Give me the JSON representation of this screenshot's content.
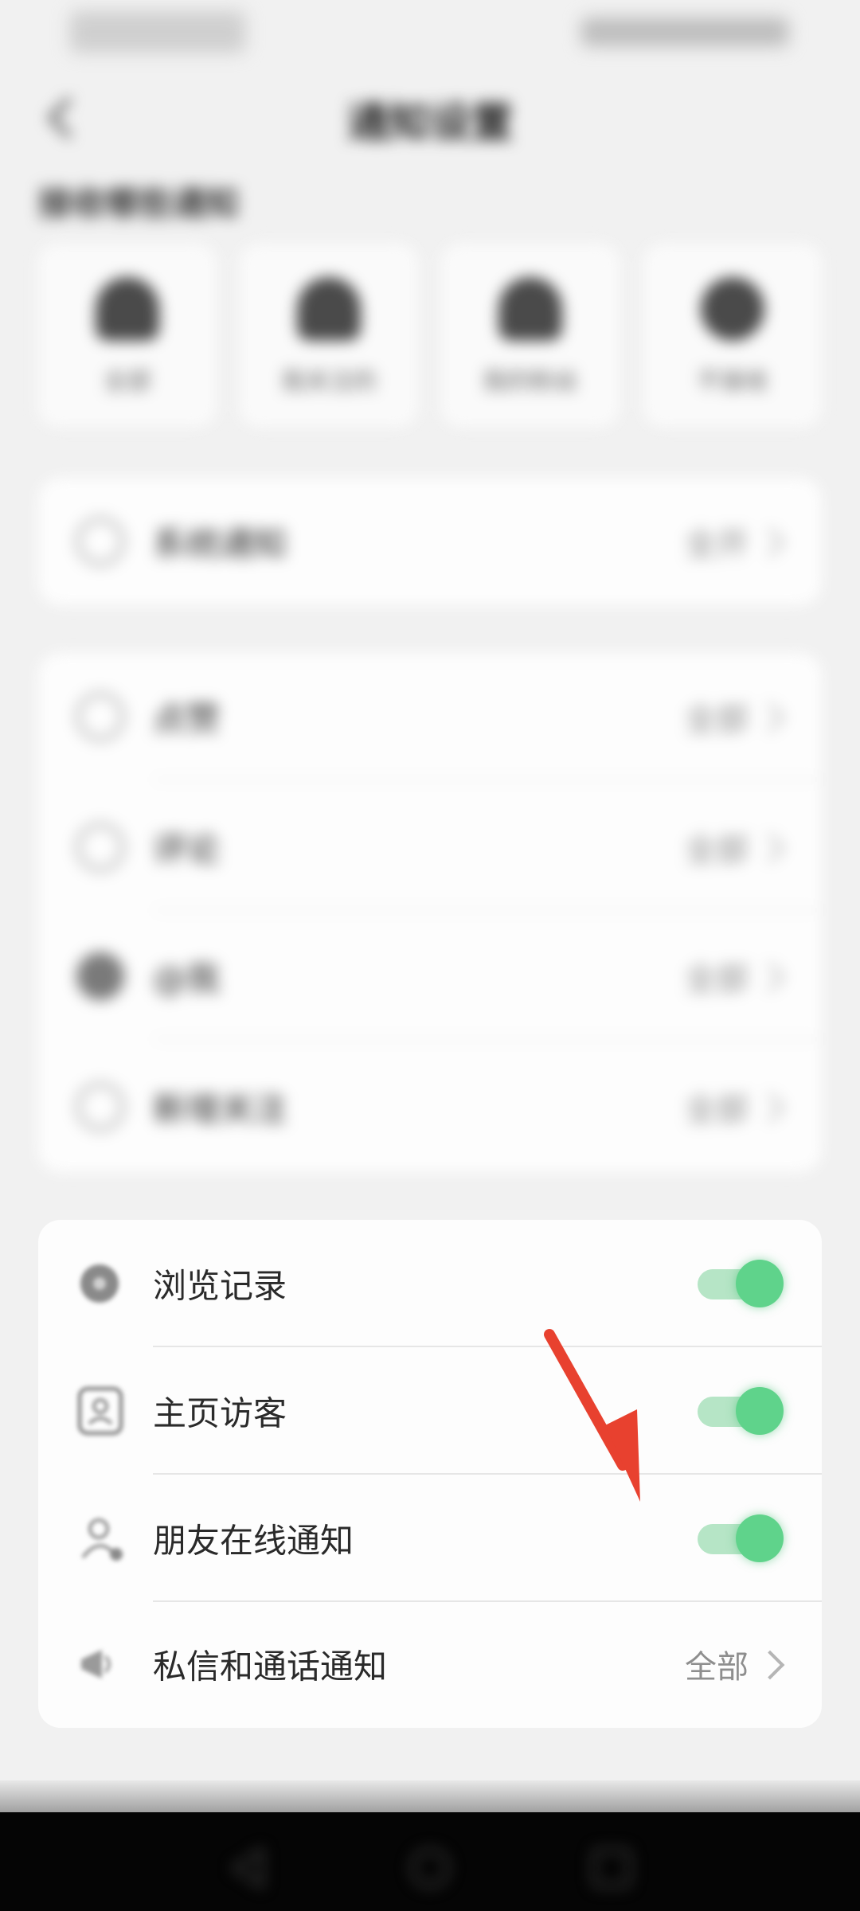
{
  "status_bar": {
    "time": "",
    "indicators": ""
  },
  "header": {
    "title": "通知设置",
    "back_icon": "chevron-left-icon"
  },
  "section": {
    "title": "接收哪些通知"
  },
  "cards": [
    {
      "label": "全部",
      "icon": "person-group-icon"
    },
    {
      "label": "我关注的",
      "icon": "person-icon"
    },
    {
      "label": "我的粉丝",
      "icon": "person-icon"
    },
    {
      "label": "不接收",
      "icon": "person-off-icon"
    }
  ],
  "panel1": {
    "label": "系统通知",
    "value": "全开"
  },
  "panel2": {
    "items": [
      {
        "label": "点赞",
        "value": "全部"
      },
      {
        "label": "评论",
        "value": "全部"
      },
      {
        "label": "@我",
        "value": "全部"
      },
      {
        "label": "新增关注",
        "value": "全部"
      }
    ]
  },
  "panel3": {
    "items": [
      {
        "label": "浏览记录",
        "toggle": true,
        "icon": "eye-icon"
      },
      {
        "label": "主页访客",
        "toggle": true,
        "icon": "profile-card-icon"
      },
      {
        "label": "朋友在线通知",
        "toggle": true,
        "icon": "person-online-icon"
      },
      {
        "label": "私信和通话通知",
        "value": "全部",
        "icon": "megaphone-icon"
      }
    ]
  },
  "colors": {
    "toggle_on": "#5fd38b",
    "annotation_arrow": "#e8412f"
  },
  "nav": {
    "back": "nav-back-icon",
    "home": "nav-home-icon",
    "recents": "nav-recents-icon"
  }
}
